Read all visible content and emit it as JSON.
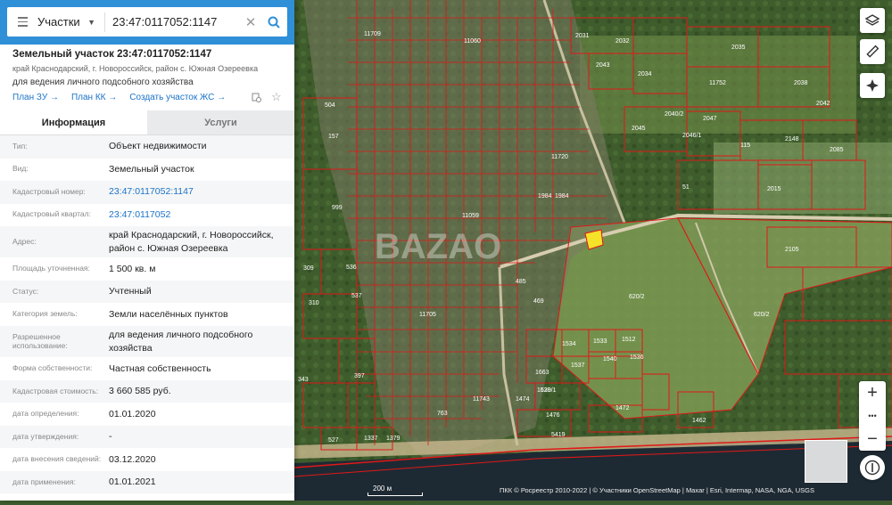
{
  "search": {
    "layer": "Участки",
    "query": "23:47:0117052:1147"
  },
  "object": {
    "title": "Земельный участок 23:47:0117052:1147",
    "address": "край Краснодарский, г. Новороссийск, район с. Южная Озереевка",
    "purpose": "для ведения личного подсобного хозяйства",
    "links": [
      "План ЗУ →",
      "План КК →",
      "Создать участок ЖС →"
    ]
  },
  "tabs": [
    "Информация",
    "Услуги"
  ],
  "info_rows": [
    {
      "key": "Тип:",
      "value": "Объект недвижимости"
    },
    {
      "key": "Вид:",
      "value": "Земельный участок"
    },
    {
      "key": "Кадастровый номер:",
      "value": "23:47:0117052:1147"
    },
    {
      "key": "Кадастровый квартал:",
      "value": "23:47:0117052"
    },
    {
      "key": "Адрес:",
      "value": "край Краснодарский, г. Новороссийск, район с. Южная Озереевка"
    },
    {
      "key": "Площадь уточненная:",
      "value": "1 500 кв. м"
    },
    {
      "key": "Статус:",
      "value": "Учтенный"
    },
    {
      "key": "Категория земель:",
      "value": "Земли населённых пунктов"
    },
    {
      "key": "Разрешенное использование:",
      "value": "для ведения личного подсобного хозяйства"
    },
    {
      "key": "Форма собственности:",
      "value": "Частная собственность"
    },
    {
      "key": "Кадастровая стоимость:",
      "value": "3 660 585 руб."
    },
    {
      "key": "дата определения:",
      "value": "01.01.2020"
    },
    {
      "key": "дата утверждения:",
      "value": "-"
    },
    {
      "key": "дата внесения сведений:",
      "value": "03.12.2020"
    },
    {
      "key": "дата применения:",
      "value": "01.01.2021"
    }
  ],
  "map": {
    "parcel_labels": [
      "2031",
      "2032",
      "2035",
      "2043",
      "2034",
      "2038",
      "11752",
      "2040/2",
      "2042",
      "2047",
      "2045",
      "2046/1",
      "115",
      "2148",
      "2085",
      "51",
      "2015",
      "2105",
      "620/2",
      "620/2",
      "1534",
      "1533",
      "1512",
      "1537",
      "1540",
      "1536",
      "1663",
      "1539",
      "1474",
      "620/1",
      "1472",
      "1476",
      "1462",
      "5419",
      "763",
      "11743",
      "11705",
      "11709",
      "504",
      "157",
      "999",
      "309",
      "536",
      "537",
      "310",
      "397",
      "343",
      "527",
      "1337",
      "1379",
      "11060",
      "11059",
      "11720",
      "1984",
      "1984",
      "485",
      "469"
    ],
    "zoom_in": "+",
    "zoom_more": "•••",
    "zoom_out": "−",
    "scale": "200 м",
    "attribution": "ПКК © Росреестр 2010-2022 | © Участники OpenStreetMap | Maxar | Esri, Intermap, NASA, NGA, USGS",
    "watermark": "BAZAO"
  },
  "colors": {
    "accent": "#2f8fd7",
    "parcel_border": "#e01818",
    "highlight": "#f5e32a",
    "link": "#1a73c8"
  },
  "icons": [
    "menu-icon",
    "chevron-down-icon",
    "close-icon",
    "search-icon",
    "copy-icon",
    "star-icon",
    "layers-icon",
    "ruler-icon",
    "locate-icon",
    "compass-icon"
  ]
}
